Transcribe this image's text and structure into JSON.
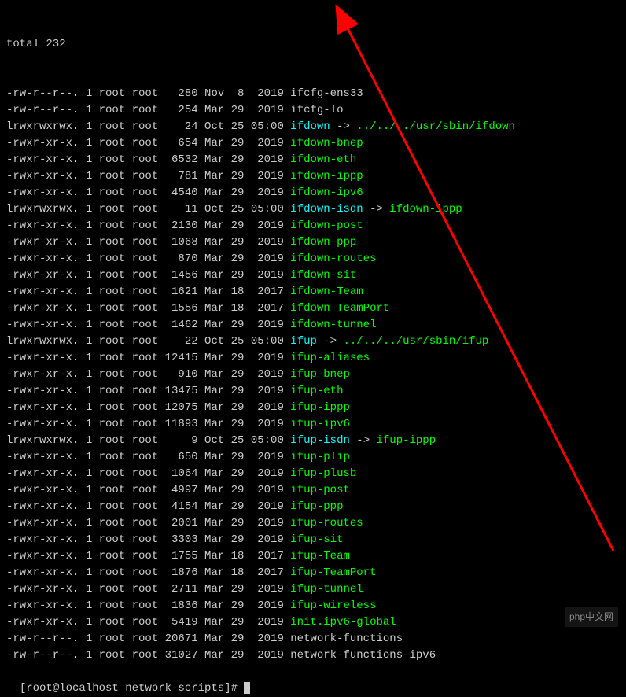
{
  "header": {
    "total_line": "total 232"
  },
  "rows": [
    {
      "perm": "-rw-r--r--.",
      "links": "1",
      "owner": "root",
      "group": "root",
      "size": "280",
      "month": "Nov",
      "day": " 8",
      "time": " 2019",
      "name": "ifcfg-ens33",
      "cls": "plain-name"
    },
    {
      "perm": "-rw-r--r--.",
      "links": "1",
      "owner": "root",
      "group": "root",
      "size": "254",
      "month": "Mar",
      "day": "29",
      "time": " 2019",
      "name": "ifcfg-lo",
      "cls": "plain-name"
    },
    {
      "perm": "lrwxrwxrwx.",
      "links": "1",
      "owner": "root",
      "group": "root",
      "size": "24",
      "month": "Oct",
      "day": "25",
      "time": "05:00",
      "name": "ifdown",
      "cls": "link-name",
      "link_target": "../../../usr/sbin/ifdown",
      "target_cls": "target-green"
    },
    {
      "perm": "-rwxr-xr-x.",
      "links": "1",
      "owner": "root",
      "group": "root",
      "size": "654",
      "month": "Mar",
      "day": "29",
      "time": " 2019",
      "name": "ifdown-bnep",
      "cls": "exec-name"
    },
    {
      "perm": "-rwxr-xr-x.",
      "links": "1",
      "owner": "root",
      "group": "root",
      "size": "6532",
      "month": "Mar",
      "day": "29",
      "time": " 2019",
      "name": "ifdown-eth",
      "cls": "exec-name"
    },
    {
      "perm": "-rwxr-xr-x.",
      "links": "1",
      "owner": "root",
      "group": "root",
      "size": "781",
      "month": "Mar",
      "day": "29",
      "time": " 2019",
      "name": "ifdown-ippp",
      "cls": "exec-name"
    },
    {
      "perm": "-rwxr-xr-x.",
      "links": "1",
      "owner": "root",
      "group": "root",
      "size": "4540",
      "month": "Mar",
      "day": "29",
      "time": " 2019",
      "name": "ifdown-ipv6",
      "cls": "exec-name"
    },
    {
      "perm": "lrwxrwxrwx.",
      "links": "1",
      "owner": "root",
      "group": "root",
      "size": "11",
      "month": "Oct",
      "day": "25",
      "time": "05:00",
      "name": "ifdown-isdn",
      "cls": "link-name",
      "link_target": "ifdown-ippp",
      "target_cls": "target-green"
    },
    {
      "perm": "-rwxr-xr-x.",
      "links": "1",
      "owner": "root",
      "group": "root",
      "size": "2130",
      "month": "Mar",
      "day": "29",
      "time": " 2019",
      "name": "ifdown-post",
      "cls": "exec-name"
    },
    {
      "perm": "-rwxr-xr-x.",
      "links": "1",
      "owner": "root",
      "group": "root",
      "size": "1068",
      "month": "Mar",
      "day": "29",
      "time": " 2019",
      "name": "ifdown-ppp",
      "cls": "exec-name"
    },
    {
      "perm": "-rwxr-xr-x.",
      "links": "1",
      "owner": "root",
      "group": "root",
      "size": "870",
      "month": "Mar",
      "day": "29",
      "time": " 2019",
      "name": "ifdown-routes",
      "cls": "exec-name"
    },
    {
      "perm": "-rwxr-xr-x.",
      "links": "1",
      "owner": "root",
      "group": "root",
      "size": "1456",
      "month": "Mar",
      "day": "29",
      "time": " 2019",
      "name": "ifdown-sit",
      "cls": "exec-name"
    },
    {
      "perm": "-rwxr-xr-x.",
      "links": "1",
      "owner": "root",
      "group": "root",
      "size": "1621",
      "month": "Mar",
      "day": "18",
      "time": " 2017",
      "name": "ifdown-Team",
      "cls": "exec-name"
    },
    {
      "perm": "-rwxr-xr-x.",
      "links": "1",
      "owner": "root",
      "group": "root",
      "size": "1556",
      "month": "Mar",
      "day": "18",
      "time": " 2017",
      "name": "ifdown-TeamPort",
      "cls": "exec-name"
    },
    {
      "perm": "-rwxr-xr-x.",
      "links": "1",
      "owner": "root",
      "group": "root",
      "size": "1462",
      "month": "Mar",
      "day": "29",
      "time": " 2019",
      "name": "ifdown-tunnel",
      "cls": "exec-name"
    },
    {
      "perm": "lrwxrwxrwx.",
      "links": "1",
      "owner": "root",
      "group": "root",
      "size": "22",
      "month": "Oct",
      "day": "25",
      "time": "05:00",
      "name": "ifup",
      "cls": "link-name",
      "link_target": "../../../usr/sbin/ifup",
      "target_cls": "target-green"
    },
    {
      "perm": "-rwxr-xr-x.",
      "links": "1",
      "owner": "root",
      "group": "root",
      "size": "12415",
      "month": "Mar",
      "day": "29",
      "time": " 2019",
      "name": "ifup-aliases",
      "cls": "exec-name"
    },
    {
      "perm": "-rwxr-xr-x.",
      "links": "1",
      "owner": "root",
      "group": "root",
      "size": "910",
      "month": "Mar",
      "day": "29",
      "time": " 2019",
      "name": "ifup-bnep",
      "cls": "exec-name"
    },
    {
      "perm": "-rwxr-xr-x.",
      "links": "1",
      "owner": "root",
      "group": "root",
      "size": "13475",
      "month": "Mar",
      "day": "29",
      "time": " 2019",
      "name": "ifup-eth",
      "cls": "exec-name"
    },
    {
      "perm": "-rwxr-xr-x.",
      "links": "1",
      "owner": "root",
      "group": "root",
      "size": "12075",
      "month": "Mar",
      "day": "29",
      "time": " 2019",
      "name": "ifup-ippp",
      "cls": "exec-name"
    },
    {
      "perm": "-rwxr-xr-x.",
      "links": "1",
      "owner": "root",
      "group": "root",
      "size": "11893",
      "month": "Mar",
      "day": "29",
      "time": " 2019",
      "name": "ifup-ipv6",
      "cls": "exec-name"
    },
    {
      "perm": "lrwxrwxrwx.",
      "links": "1",
      "owner": "root",
      "group": "root",
      "size": "9",
      "month": "Oct",
      "day": "25",
      "time": "05:00",
      "name": "ifup-isdn",
      "cls": "link-name",
      "link_target": "ifup-ippp",
      "target_cls": "target-green"
    },
    {
      "perm": "-rwxr-xr-x.",
      "links": "1",
      "owner": "root",
      "group": "root",
      "size": "650",
      "month": "Mar",
      "day": "29",
      "time": " 2019",
      "name": "ifup-plip",
      "cls": "exec-name"
    },
    {
      "perm": "-rwxr-xr-x.",
      "links": "1",
      "owner": "root",
      "group": "root",
      "size": "1064",
      "month": "Mar",
      "day": "29",
      "time": " 2019",
      "name": "ifup-plusb",
      "cls": "exec-name"
    },
    {
      "perm": "-rwxr-xr-x.",
      "links": "1",
      "owner": "root",
      "group": "root",
      "size": "4997",
      "month": "Mar",
      "day": "29",
      "time": " 2019",
      "name": "ifup-post",
      "cls": "exec-name"
    },
    {
      "perm": "-rwxr-xr-x.",
      "links": "1",
      "owner": "root",
      "group": "root",
      "size": "4154",
      "month": "Mar",
      "day": "29",
      "time": " 2019",
      "name": "ifup-ppp",
      "cls": "exec-name"
    },
    {
      "perm": "-rwxr-xr-x.",
      "links": "1",
      "owner": "root",
      "group": "root",
      "size": "2001",
      "month": "Mar",
      "day": "29",
      "time": " 2019",
      "name": "ifup-routes",
      "cls": "exec-name"
    },
    {
      "perm": "-rwxr-xr-x.",
      "links": "1",
      "owner": "root",
      "group": "root",
      "size": "3303",
      "month": "Mar",
      "day": "29",
      "time": " 2019",
      "name": "ifup-sit",
      "cls": "exec-name"
    },
    {
      "perm": "-rwxr-xr-x.",
      "links": "1",
      "owner": "root",
      "group": "root",
      "size": "1755",
      "month": "Mar",
      "day": "18",
      "time": " 2017",
      "name": "ifup-Team",
      "cls": "exec-name"
    },
    {
      "perm": "-rwxr-xr-x.",
      "links": "1",
      "owner": "root",
      "group": "root",
      "size": "1876",
      "month": "Mar",
      "day": "18",
      "time": " 2017",
      "name": "ifup-TeamPort",
      "cls": "exec-name"
    },
    {
      "perm": "-rwxr-xr-x.",
      "links": "1",
      "owner": "root",
      "group": "root",
      "size": "2711",
      "month": "Mar",
      "day": "29",
      "time": " 2019",
      "name": "ifup-tunnel",
      "cls": "exec-name"
    },
    {
      "perm": "-rwxr-xr-x.",
      "links": "1",
      "owner": "root",
      "group": "root",
      "size": "1836",
      "month": "Mar",
      "day": "29",
      "time": " 2019",
      "name": "ifup-wireless",
      "cls": "exec-name"
    },
    {
      "perm": "-rwxr-xr-x.",
      "links": "1",
      "owner": "root",
      "group": "root",
      "size": "5419",
      "month": "Mar",
      "day": "29",
      "time": " 2019",
      "name": "init.ipv6-global",
      "cls": "exec-name"
    },
    {
      "perm": "-rw-r--r--.",
      "links": "1",
      "owner": "root",
      "group": "root",
      "size": "20671",
      "month": "Mar",
      "day": "29",
      "time": " 2019",
      "name": "network-functions",
      "cls": "plain-name"
    },
    {
      "perm": "-rw-r--r--.",
      "links": "1",
      "owner": "root",
      "group": "root",
      "size": "31027",
      "month": "Mar",
      "day": "29",
      "time": " 2019",
      "name": "network-functions-ipv6",
      "cls": "plain-name"
    }
  ],
  "prompt": {
    "text": "[root@localhost network-scripts]# "
  },
  "watermark": {
    "text": "php中文网"
  },
  "arrow_symbol": " -> "
}
